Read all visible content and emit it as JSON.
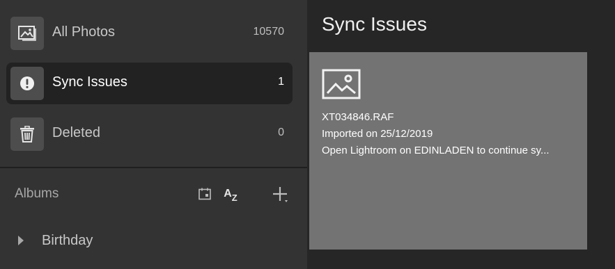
{
  "sidebar": {
    "items": [
      {
        "label": "All Photos",
        "count": "10570",
        "icon": "image-icon"
      },
      {
        "label": "Sync Issues",
        "count": "1",
        "icon": "alert-icon"
      },
      {
        "label": "Deleted",
        "count": "0",
        "icon": "trash-icon"
      }
    ],
    "albums": {
      "header": "Albums",
      "sort_az_label": "A",
      "sort_az_sub": "Z",
      "items": [
        {
          "label": "Birthday"
        }
      ]
    }
  },
  "main": {
    "title": "Sync Issues",
    "card": {
      "filename": "XT034846.RAF",
      "imported": "Imported on 25/12/2019",
      "message": "Open Lightroom on EDINLADEN to continue sy..."
    }
  },
  "colors": {
    "sidebar_bg": "#333333",
    "active_bg": "#222222",
    "main_bg": "#262626",
    "card_bg": "#737373"
  }
}
